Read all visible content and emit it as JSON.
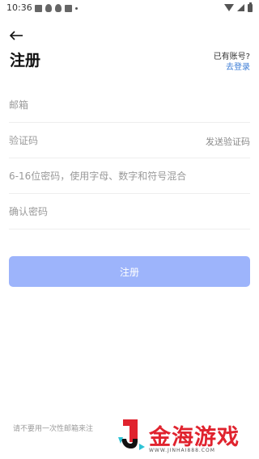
{
  "status_bar": {
    "time": "10:36",
    "icons": [
      "image-icon",
      "qq-icon",
      "qq-icon",
      "app-icon",
      "dot-icon",
      "wifi-icon",
      "signal-icon",
      "battery-icon"
    ]
  },
  "header": {
    "back_icon": "arrow-left-icon",
    "title": "注册",
    "has_account": "已有账号?",
    "login_link": "去登录"
  },
  "form": {
    "email_placeholder": "邮箱",
    "code_placeholder": "验证码",
    "send_code": "发送验证码",
    "password_placeholder": "6-16位密码，使用字母、数字和符号混合",
    "confirm_placeholder": "确认密码",
    "submit": "注册"
  },
  "notice": "请不要用一次性邮箱来注",
  "watermark": {
    "name": "金海游戏",
    "url": "WWW.JINHAI888.COM"
  },
  "colors": {
    "accent_link": "#3a7bd5",
    "button": "#9db4fb",
    "watermark_red": "#e0232e"
  }
}
